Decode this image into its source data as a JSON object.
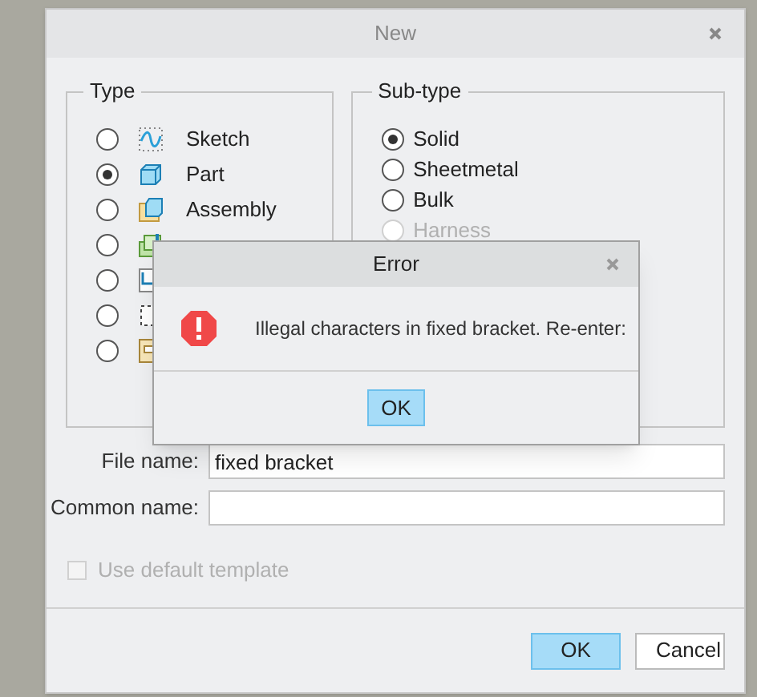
{
  "window": {
    "title": "New"
  },
  "type_group": {
    "title": "Type",
    "items": [
      {
        "label": "Sketch",
        "selected": false
      },
      {
        "label": "Part",
        "selected": true
      },
      {
        "label": "Assembly",
        "selected": false
      },
      {
        "selected": false
      },
      {
        "selected": false
      },
      {
        "selected": false
      },
      {
        "selected": false
      }
    ]
  },
  "subtype_group": {
    "title": "Sub-type",
    "items": [
      {
        "label": "Solid",
        "selected": true,
        "disabled": false
      },
      {
        "label": "Sheetmetal",
        "selected": false,
        "disabled": false
      },
      {
        "label": "Bulk",
        "selected": false,
        "disabled": false
      },
      {
        "label": "Harness",
        "selected": false,
        "disabled": true
      }
    ]
  },
  "fields": [
    {
      "label": "File name:",
      "value": "fixed bracket"
    },
    {
      "label": "Common name:"
    }
  ],
  "use_default_template": {
    "label": "Use default template",
    "checked": false,
    "disabled": true
  },
  "buttons": [
    {
      "label": "OK",
      "default": true
    },
    {
      "label": "Cancel",
      "default": false
    }
  ],
  "error_dialog": {
    "title": "Error",
    "message": "Illegal characters in fixed bracket. Re-enter:",
    "buttons": [
      {
        "label": "OK",
        "default": true
      }
    ]
  }
}
